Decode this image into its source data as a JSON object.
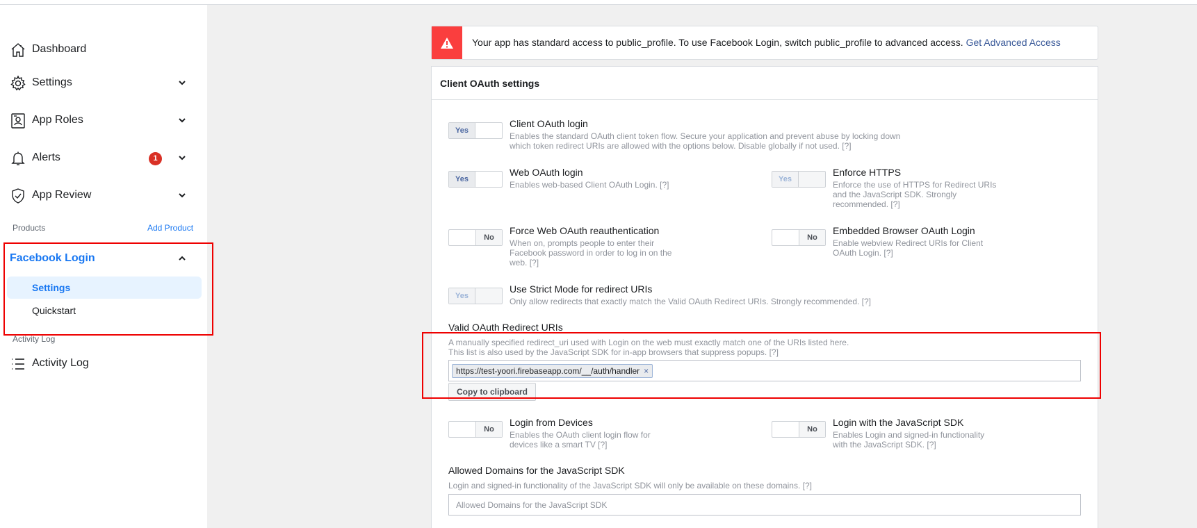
{
  "sidebar": {
    "items": [
      {
        "label": "Dashboard",
        "icon": "home-icon"
      },
      {
        "label": "Settings",
        "icon": "gear-icon"
      },
      {
        "label": "App Roles",
        "icon": "person-badge-icon"
      },
      {
        "label": "Alerts",
        "icon": "bell-icon",
        "badge": "1"
      },
      {
        "label": "App Review",
        "icon": "shield-check-icon"
      }
    ],
    "products_label": "Products",
    "add_product": "Add Product",
    "facebook_login": {
      "label": "Facebook Login",
      "subitems": [
        {
          "label": "Settings",
          "active": true
        },
        {
          "label": "Quickstart",
          "active": false
        }
      ]
    },
    "activity_section_label": "Activity Log",
    "activity_log": {
      "label": "Activity Log",
      "icon": "list-icon"
    }
  },
  "alert": {
    "text": "Your app has standard access to public_profile. To use Facebook Login, switch public_profile to advanced access.",
    "link": "Get Advanced Access",
    "icon": "warning-icon",
    "color": "#fa3e3e"
  },
  "panel": {
    "title": "Client OAuth settings",
    "help": "[?]",
    "options": {
      "client_oauth": {
        "title": "Client OAuth login",
        "desc1": "Enables the standard OAuth client token flow. Secure your application and prevent abuse by locking down",
        "desc2": "which token redirect URIs are allowed with the options below. Disable globally if not used.",
        "toggle": "Yes"
      },
      "web_oauth": {
        "title": "Web OAuth login",
        "desc1": "Enables web-based Client OAuth Login.",
        "toggle": "Yes"
      },
      "enforce_https": {
        "title": "Enforce HTTPS",
        "desc1": "Enforce the use of HTTPS for Redirect URIs",
        "desc2": "and the JavaScript SDK. Strongly",
        "desc3": "recommended.",
        "toggle": "Yes"
      },
      "force_reauth": {
        "title": "Force Web OAuth reauthentication",
        "desc1": "When on, prompts people to enter their",
        "desc2": "Facebook password in order to log in on the",
        "desc3": "web.",
        "toggle": "No"
      },
      "embedded_browser": {
        "title": "Embedded Browser OAuth Login",
        "desc1": "Enable webview Redirect URIs for Client",
        "desc2": "OAuth Login.",
        "toggle": "No"
      },
      "strict_mode": {
        "title": "Use Strict Mode for redirect URIs",
        "desc1": "Only allow redirects that exactly match the Valid OAuth Redirect URIs. Strongly recommended.",
        "toggle": "Yes"
      },
      "login_devices": {
        "title": "Login from Devices",
        "desc1": "Enables the OAuth client login flow for",
        "desc2": "devices like a smart TV",
        "toggle": "No"
      },
      "login_js_sdk": {
        "title": "Login with the JavaScript SDK",
        "desc1": "Enables Login and signed-in functionality",
        "desc2": "with the JavaScript SDK.",
        "toggle": "No"
      }
    },
    "redirect_uris": {
      "title": "Valid OAuth Redirect URIs",
      "desc1": "A manually specified redirect_uri used with Login on the web must exactly match one of the URIs listed here.",
      "desc2": "This list is also used by the JavaScript SDK for in-app browsers that suppress popups.",
      "uri": "https://test-yoori.firebaseapp.com/__/auth/handler",
      "remove": "×",
      "copy": "Copy to clipboard"
    },
    "allowed_domains": {
      "title": "Allowed Domains for the JavaScript SDK",
      "desc": "Login and signed-in functionality of the JavaScript SDK will only be available on these domains.",
      "placeholder": "Allowed Domains for the JavaScript SDK"
    }
  }
}
